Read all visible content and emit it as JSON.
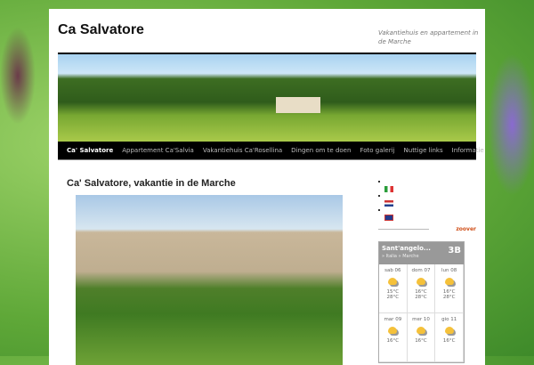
{
  "header": {
    "title": "Ca Salvatore",
    "tagline": "Vakantiehuis en appartement in de Marche"
  },
  "nav": [
    {
      "label": "Ca' Salvatore"
    },
    {
      "label": "Appartement Ca'Salvia"
    },
    {
      "label": "Vakantiehuis Ca'Rosellina"
    },
    {
      "label": "Dingen om te doen"
    },
    {
      "label": "Foto galerij"
    },
    {
      "label": "Nuttige links"
    },
    {
      "label": "Informatie"
    }
  ],
  "post": {
    "title": "Ca' Salvatore, vakantie in de Marche"
  },
  "sidebar": {
    "flags": [
      "italian-flag",
      "dutch-flag",
      "uk-flag"
    ],
    "zoover": "zoover",
    "weather": {
      "city": "Sant'angelo...",
      "breadcrumb": "» Italia » Marche",
      "logo": "3B",
      "days": [
        {
          "day": "sab 06",
          "min": "15°C",
          "max": "28°C"
        },
        {
          "day": "dom 07",
          "min": "16°C",
          "max": "28°C"
        },
        {
          "day": "lun 08",
          "min": "16°C",
          "max": "28°C"
        },
        {
          "day": "mar 09",
          "min": "16°C",
          "max": ""
        },
        {
          "day": "mer 10",
          "min": "16°C",
          "max": ""
        },
        {
          "day": "gio 11",
          "min": "16°C",
          "max": ""
        }
      ]
    }
  }
}
